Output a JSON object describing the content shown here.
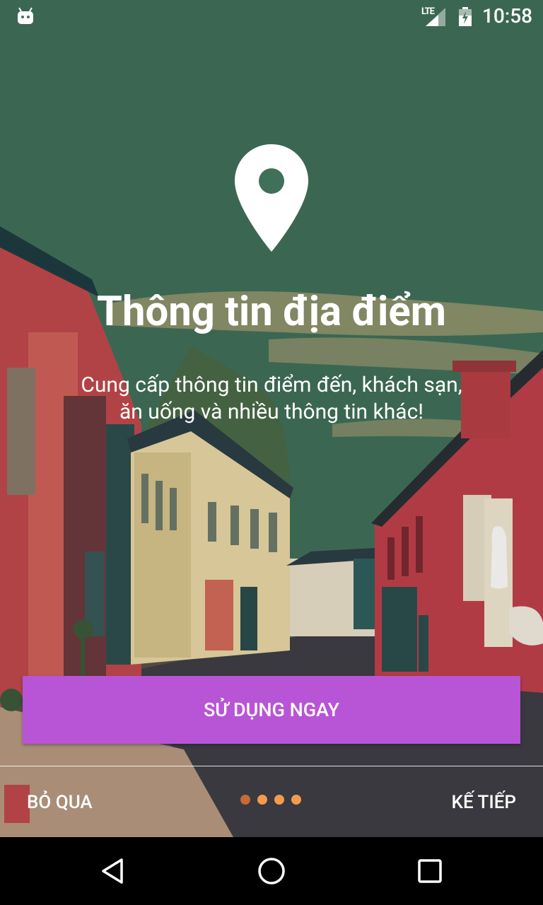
{
  "status_bar": {
    "network": "LTE",
    "time": "10:58"
  },
  "onboarding": {
    "title": "Thông tin địa điểm",
    "description_line1": "Cung cấp thông tin điểm đến, khách sạn,",
    "description_line2": "ăn uống và nhiều thông tin khác!",
    "primary_button": "SỬ DỤNG NGAY",
    "skip": "BỎ QUA",
    "next": "KẾ TIẾP",
    "page_count": 4,
    "current_page": 1
  },
  "icons": {
    "status": [
      "android-icon",
      "signal-icon",
      "battery-icon"
    ],
    "content": "location-pin-icon",
    "nav": [
      "back-icon",
      "home-icon",
      "recents-icon"
    ]
  },
  "colors": {
    "sky": "#41705a",
    "button": "#b854d6",
    "dot": "#f39a4e",
    "dot_active": "#c56a39",
    "nav_bar": "#000000"
  }
}
